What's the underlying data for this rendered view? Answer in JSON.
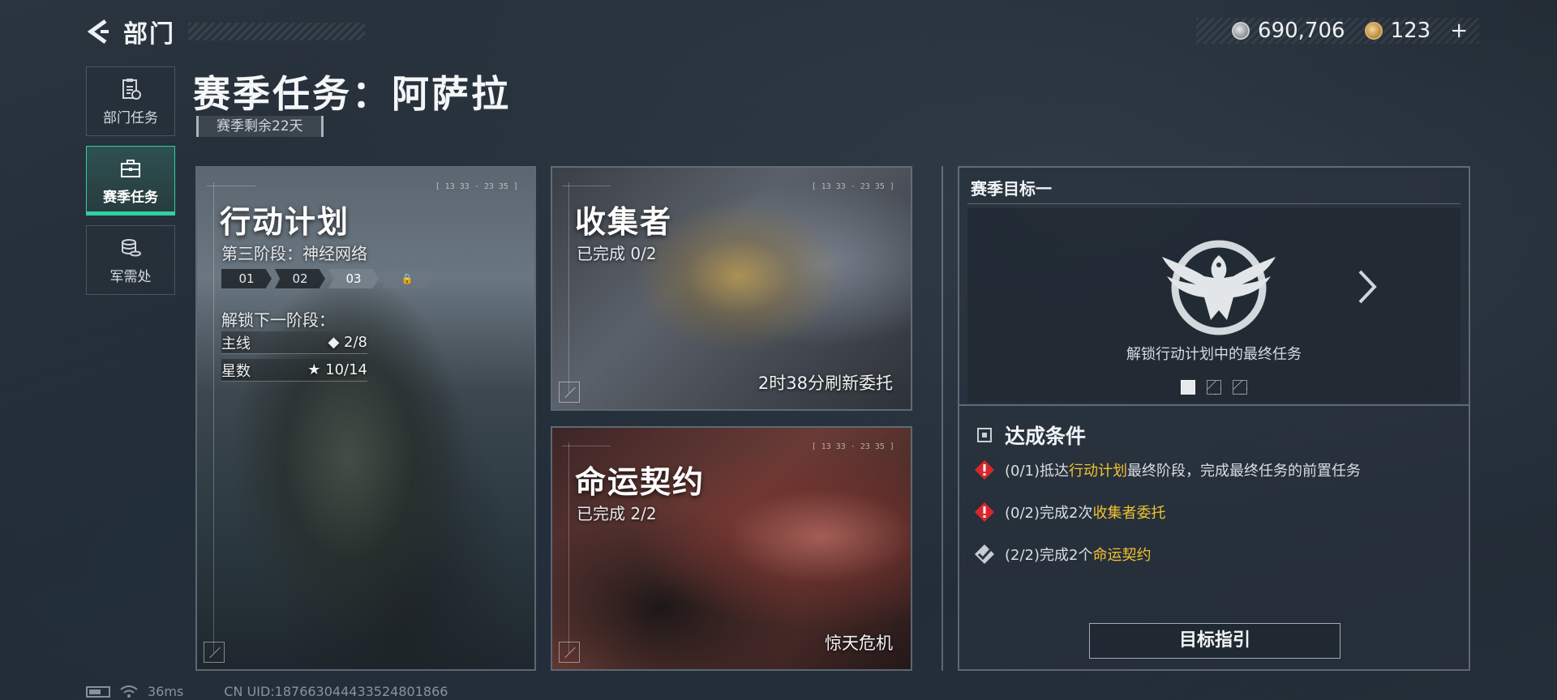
{
  "nav": {
    "back_label": "部门"
  },
  "currency": {
    "silver": "690,706",
    "gold": "123",
    "gold_add": "+"
  },
  "sidebar": {
    "items": [
      {
        "label": "部门任务",
        "icon": "task-clipboard-icon",
        "active": false
      },
      {
        "label": "赛季任务",
        "icon": "season-briefcase-icon",
        "active": true
      },
      {
        "label": "军需处",
        "icon": "coin-stack-icon",
        "active": false
      }
    ]
  },
  "header": {
    "title": "赛季任务：阿萨拉",
    "time_left": "赛季剩余22天"
  },
  "cards": {
    "plan": {
      "title": "行动计划",
      "phase": "第三阶段：神经网络",
      "stages": [
        "01",
        "02",
        "03",
        "🔒"
      ],
      "current_stage": "03",
      "unlock_label": "解锁下一阶段：",
      "main_label": "主线",
      "main_value": "◆ 2/8",
      "stars_label": "星数",
      "stars_value": "★ 10/14",
      "stamp": "[ 13 33 · 23 35 ]"
    },
    "collector": {
      "title": "收集者",
      "progress": "已完成 0/2",
      "refresh": "2时38分刷新委托",
      "stamp": "[ 13 33 · 23 35 ]"
    },
    "contract": {
      "title": "命运契约",
      "progress": "已完成 2/2",
      "footer": "惊天危机",
      "stamp": "[ 13 33 · 23 35 ]"
    }
  },
  "goal": {
    "heading": "赛季目标一",
    "caption": "解锁行动计划中的最终任务",
    "conditions_title": "达成条件",
    "conditions": [
      {
        "status": "incomplete",
        "prefix": "(0/1)抵达",
        "highlight": "行动计划",
        "suffix": "最终阶段，完成最终任务的前置任务"
      },
      {
        "status": "incomplete",
        "prefix": "(0/2)完成2次",
        "highlight": "收集者委托",
        "suffix": ""
      },
      {
        "status": "complete",
        "prefix": "(2/2)完成2个",
        "highlight": "命运契约",
        "suffix": ""
      }
    ],
    "button_label": "目标指引"
  },
  "footer": {
    "ping": "36ms",
    "uid": "CN UID:187663044433524801866"
  },
  "colors": {
    "accent": "#2fd1a2",
    "highlight": "#f2c230",
    "warning": "#d9262c"
  }
}
